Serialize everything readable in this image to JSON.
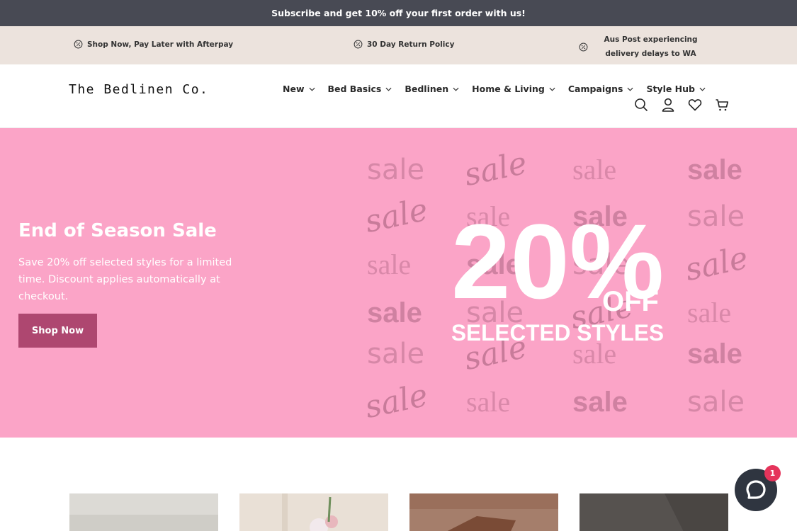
{
  "announcement": "Subscribe and get 10% off your first order with us!",
  "usps": [
    {
      "label": "Shop Now, Pay Later with Afterpay",
      "icon": "percent-badge-icon"
    },
    {
      "label": "30 Day Return Policy",
      "icon": "percent-badge-icon"
    },
    {
      "label": "Aus Post experiencing delivery delays to WA",
      "icon": "percent-badge-icon"
    }
  ],
  "header": {
    "logo": "The Bedlinen Co.",
    "nav": [
      {
        "label": "New"
      },
      {
        "label": "Bed Basics"
      },
      {
        "label": "Bedlinen"
      },
      {
        "label": "Home & Living"
      },
      {
        "label": "Campaigns"
      },
      {
        "label": "Style Hub"
      }
    ],
    "icons": [
      "search-icon",
      "account-icon",
      "wishlist-heart-icon",
      "cart-icon"
    ]
  },
  "hero": {
    "title": "End of Season Sale",
    "text": "Save 20% off selected styles for a limited time. Discount applies automatically at checkout.",
    "button": "Shop Now",
    "promo_big": "20%",
    "promo_off": "OFF",
    "promo_sub": "SELECTED STYLES",
    "promo_word": "sale",
    "bg_color": "#fba4c7",
    "button_color": "#ae4770"
  },
  "chat": {
    "badge": "1",
    "icon": "chat-bubble-icon"
  },
  "colors": {
    "announcement_bg": "#484a54",
    "usp_bg": "#ece3dd"
  }
}
